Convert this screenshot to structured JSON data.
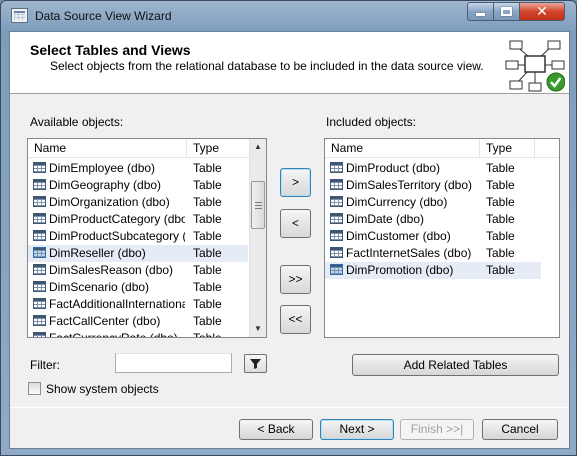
{
  "window": {
    "title": "Data Source View Wizard"
  },
  "header": {
    "title": "Select Tables and Views",
    "subtitle": "Select objects from the relational database to be included in the data source view."
  },
  "available": {
    "label": "Available objects:",
    "columns": {
      "name": "Name",
      "type": "Type"
    },
    "rows": [
      {
        "name": "DimEmployee (dbo)",
        "type": "Table"
      },
      {
        "name": "DimGeography (dbo)",
        "type": "Table"
      },
      {
        "name": "DimOrganization (dbo)",
        "type": "Table"
      },
      {
        "name": "DimProductCategory (dbo)",
        "type": "Table"
      },
      {
        "name": "DimProductSubcategory (...",
        "type": "Table"
      },
      {
        "name": "DimReseller (dbo)",
        "type": "Table"
      },
      {
        "name": "DimSalesReason (dbo)",
        "type": "Table"
      },
      {
        "name": "DimScenario (dbo)",
        "type": "Table"
      },
      {
        "name": "FactAdditionalInternational...",
        "type": "Table"
      },
      {
        "name": "FactCallCenter (dbo)",
        "type": "Table"
      },
      {
        "name": "FactCurrencyRate (dbo)",
        "type": "Table"
      }
    ],
    "selected_index": 5
  },
  "included": {
    "label": "Included objects:",
    "columns": {
      "name": "Name",
      "type": "Type"
    },
    "rows": [
      {
        "name": "DimProduct (dbo)",
        "type": "Table"
      },
      {
        "name": "DimSalesTerritory (dbo)",
        "type": "Table"
      },
      {
        "name": "DimCurrency (dbo)",
        "type": "Table"
      },
      {
        "name": "DimDate (dbo)",
        "type": "Table"
      },
      {
        "name": "DimCustomer (dbo)",
        "type": "Table"
      },
      {
        "name": "FactInternetSales (dbo)",
        "type": "Table"
      },
      {
        "name": "DimPromotion (dbo)",
        "type": "Table"
      }
    ],
    "selected_index": 6
  },
  "move_buttons": {
    "add": ">",
    "remove": "<",
    "add_all": ">>",
    "remove_all": "<<"
  },
  "filter": {
    "label": "Filter:",
    "value": ""
  },
  "add_related": "Add Related Tables",
  "show_system": {
    "label": "Show system objects",
    "checked": false
  },
  "footer": {
    "back": "< Back",
    "next": "Next >",
    "finish": "Finish >>|",
    "cancel": "Cancel"
  }
}
